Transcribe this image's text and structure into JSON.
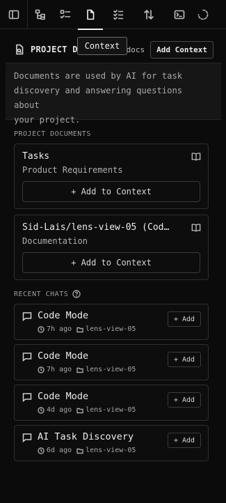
{
  "tooltip": "Context",
  "header": {
    "title": "PROJECT D",
    "docs_text": "docs",
    "add_context_label": "Add Context"
  },
  "info": {
    "lines": [
      "Documents are used by AI for task",
      "discovery and answering questions about",
      "your project."
    ]
  },
  "project_documents": {
    "label": "PROJECT DOCUMENTS",
    "items": [
      {
        "title": "Tasks",
        "subtitle": "Product Requirements",
        "add_label": "+ Add to Context"
      },
      {
        "title": "Sid-Lais/lens-view-05 (Cod…",
        "subtitle": "Documentation",
        "add_label": "+ Add to Context"
      }
    ]
  },
  "recent_chats": {
    "label": "RECENT CHATS",
    "items": [
      {
        "title": "Code Mode",
        "time": "7h ago",
        "folder": "lens-view-05",
        "add_label": "+ Add"
      },
      {
        "title": "Code Mode",
        "time": "7h ago",
        "folder": "lens-view-05",
        "add_label": "+ Add"
      },
      {
        "title": "Code Mode",
        "time": "4d ago",
        "folder": "lens-view-05",
        "add_label": "+ Add"
      },
      {
        "title": "AI Task Discovery",
        "time": "6d ago",
        "folder": "lens-view-05",
        "add_label": "+ Add"
      }
    ]
  },
  "icons": {
    "toolbar": [
      "sidebar-toggle-icon",
      "tree-icon",
      "checklist-icon",
      "document-icon",
      "tasks-icon",
      "sort-icon",
      "terminal-icon",
      "loading-icon"
    ]
  },
  "colors": {
    "background": "#0b0b0b",
    "card_border": "#2f2f2f",
    "text_primary": "#ececec",
    "text_secondary": "#a8a8a8"
  }
}
